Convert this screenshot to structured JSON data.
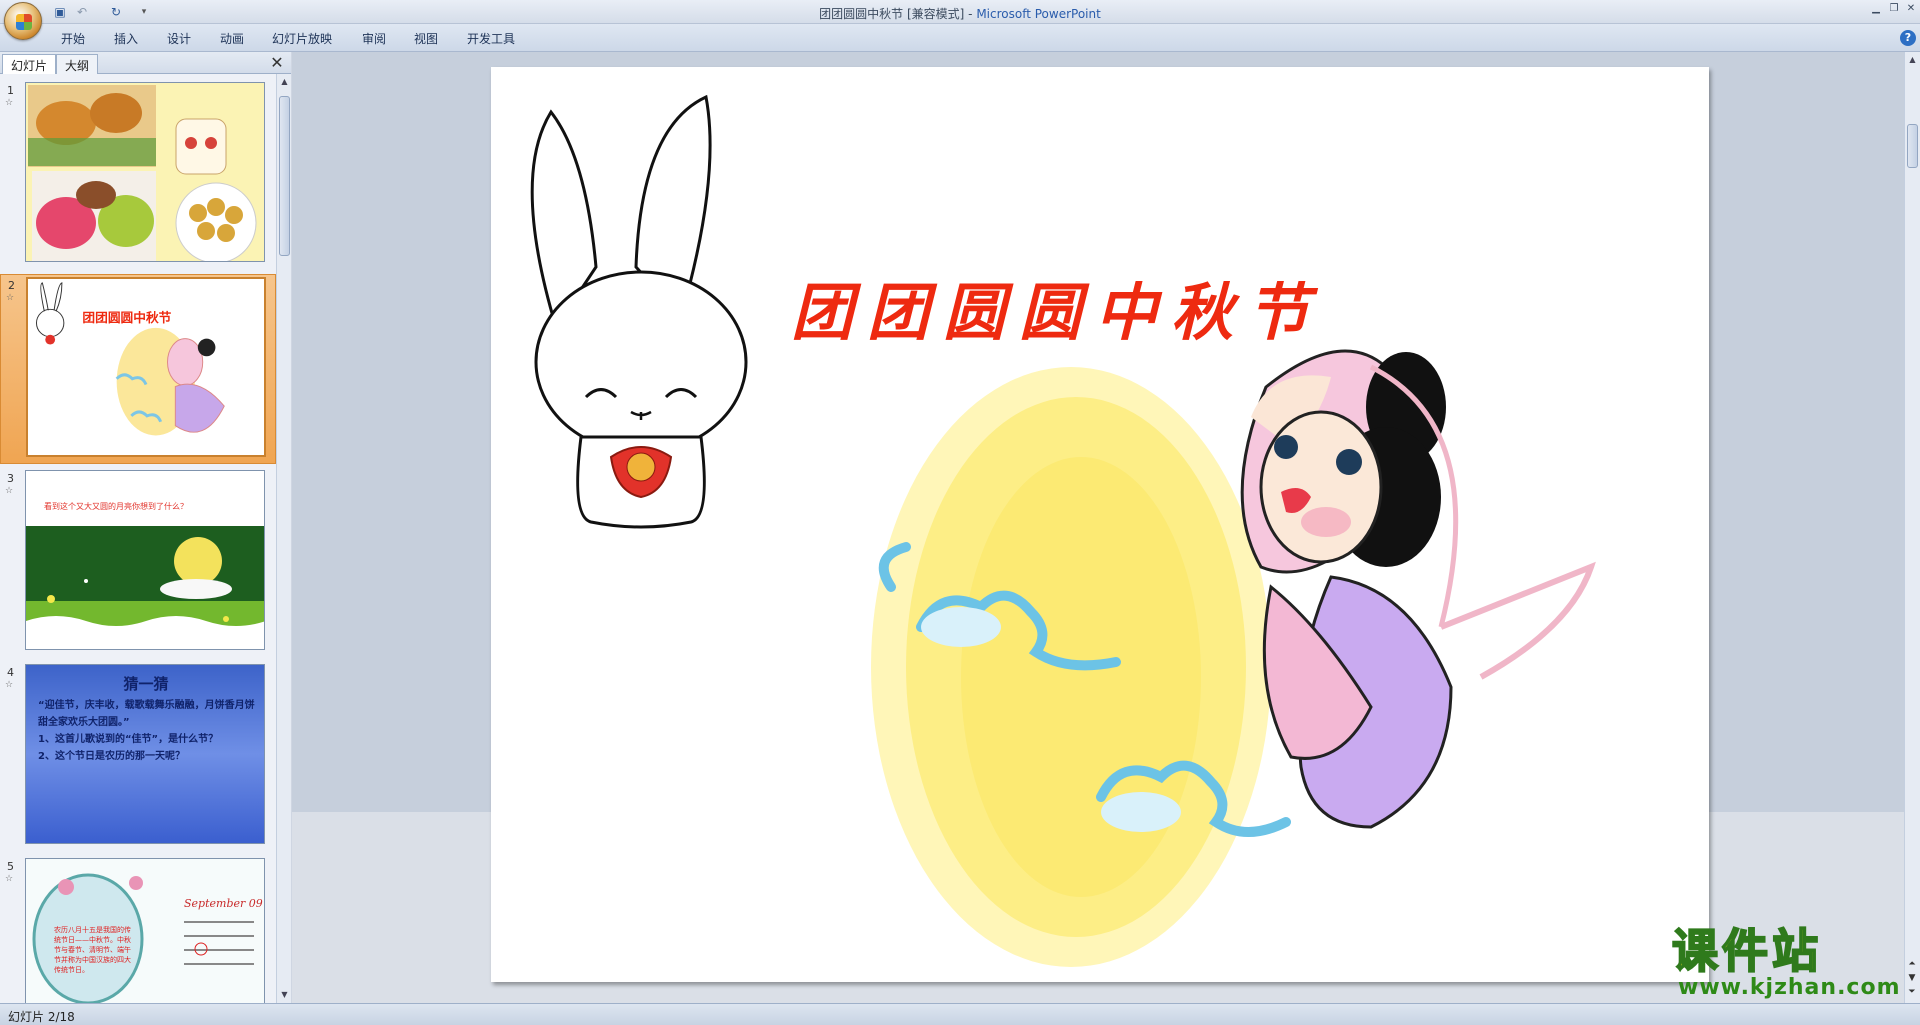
{
  "titlebar": {
    "document": "团团圆圆中秋节 [兼容模式]",
    "separator": " - ",
    "app": "Microsoft PowerPoint"
  },
  "ribbon": {
    "tabs": [
      "开始",
      "插入",
      "设计",
      "动画",
      "幻灯片放映",
      "审阅",
      "视图",
      "开发工具"
    ]
  },
  "pane": {
    "tab_slides": "幻灯片",
    "tab_outline": "大纲"
  },
  "thumbnails": [
    {
      "number": "1"
    },
    {
      "number": "2",
      "title": "团团圆圆中秋节"
    },
    {
      "number": "3",
      "text": "看到这个又大又圆的月亮你想到了什么？"
    },
    {
      "number": "4",
      "title": "猜一猜",
      "lines": [
        "“迎佳节，庆丰收，载歌载舞乐融融，月饼香月饼甜全家欢乐大团圆。”",
        "1、这首儿歌说到的“佳节”，是什么节？",
        "2、这个节日是农历的那一天呢？"
      ]
    },
    {
      "number": "5",
      "month": "September 09",
      "text": "农历八月十五是我国的传统节日——中秋节。中秋节与春节、清明节、端午节并称为中国汉族的四大传统节日。"
    }
  ],
  "slide": {
    "title": "团团圆圆中秋节"
  },
  "status": {
    "text": "幻灯片 2/18"
  },
  "watermark": {
    "main": "课件站",
    "url": "www.kjzhan.com"
  }
}
